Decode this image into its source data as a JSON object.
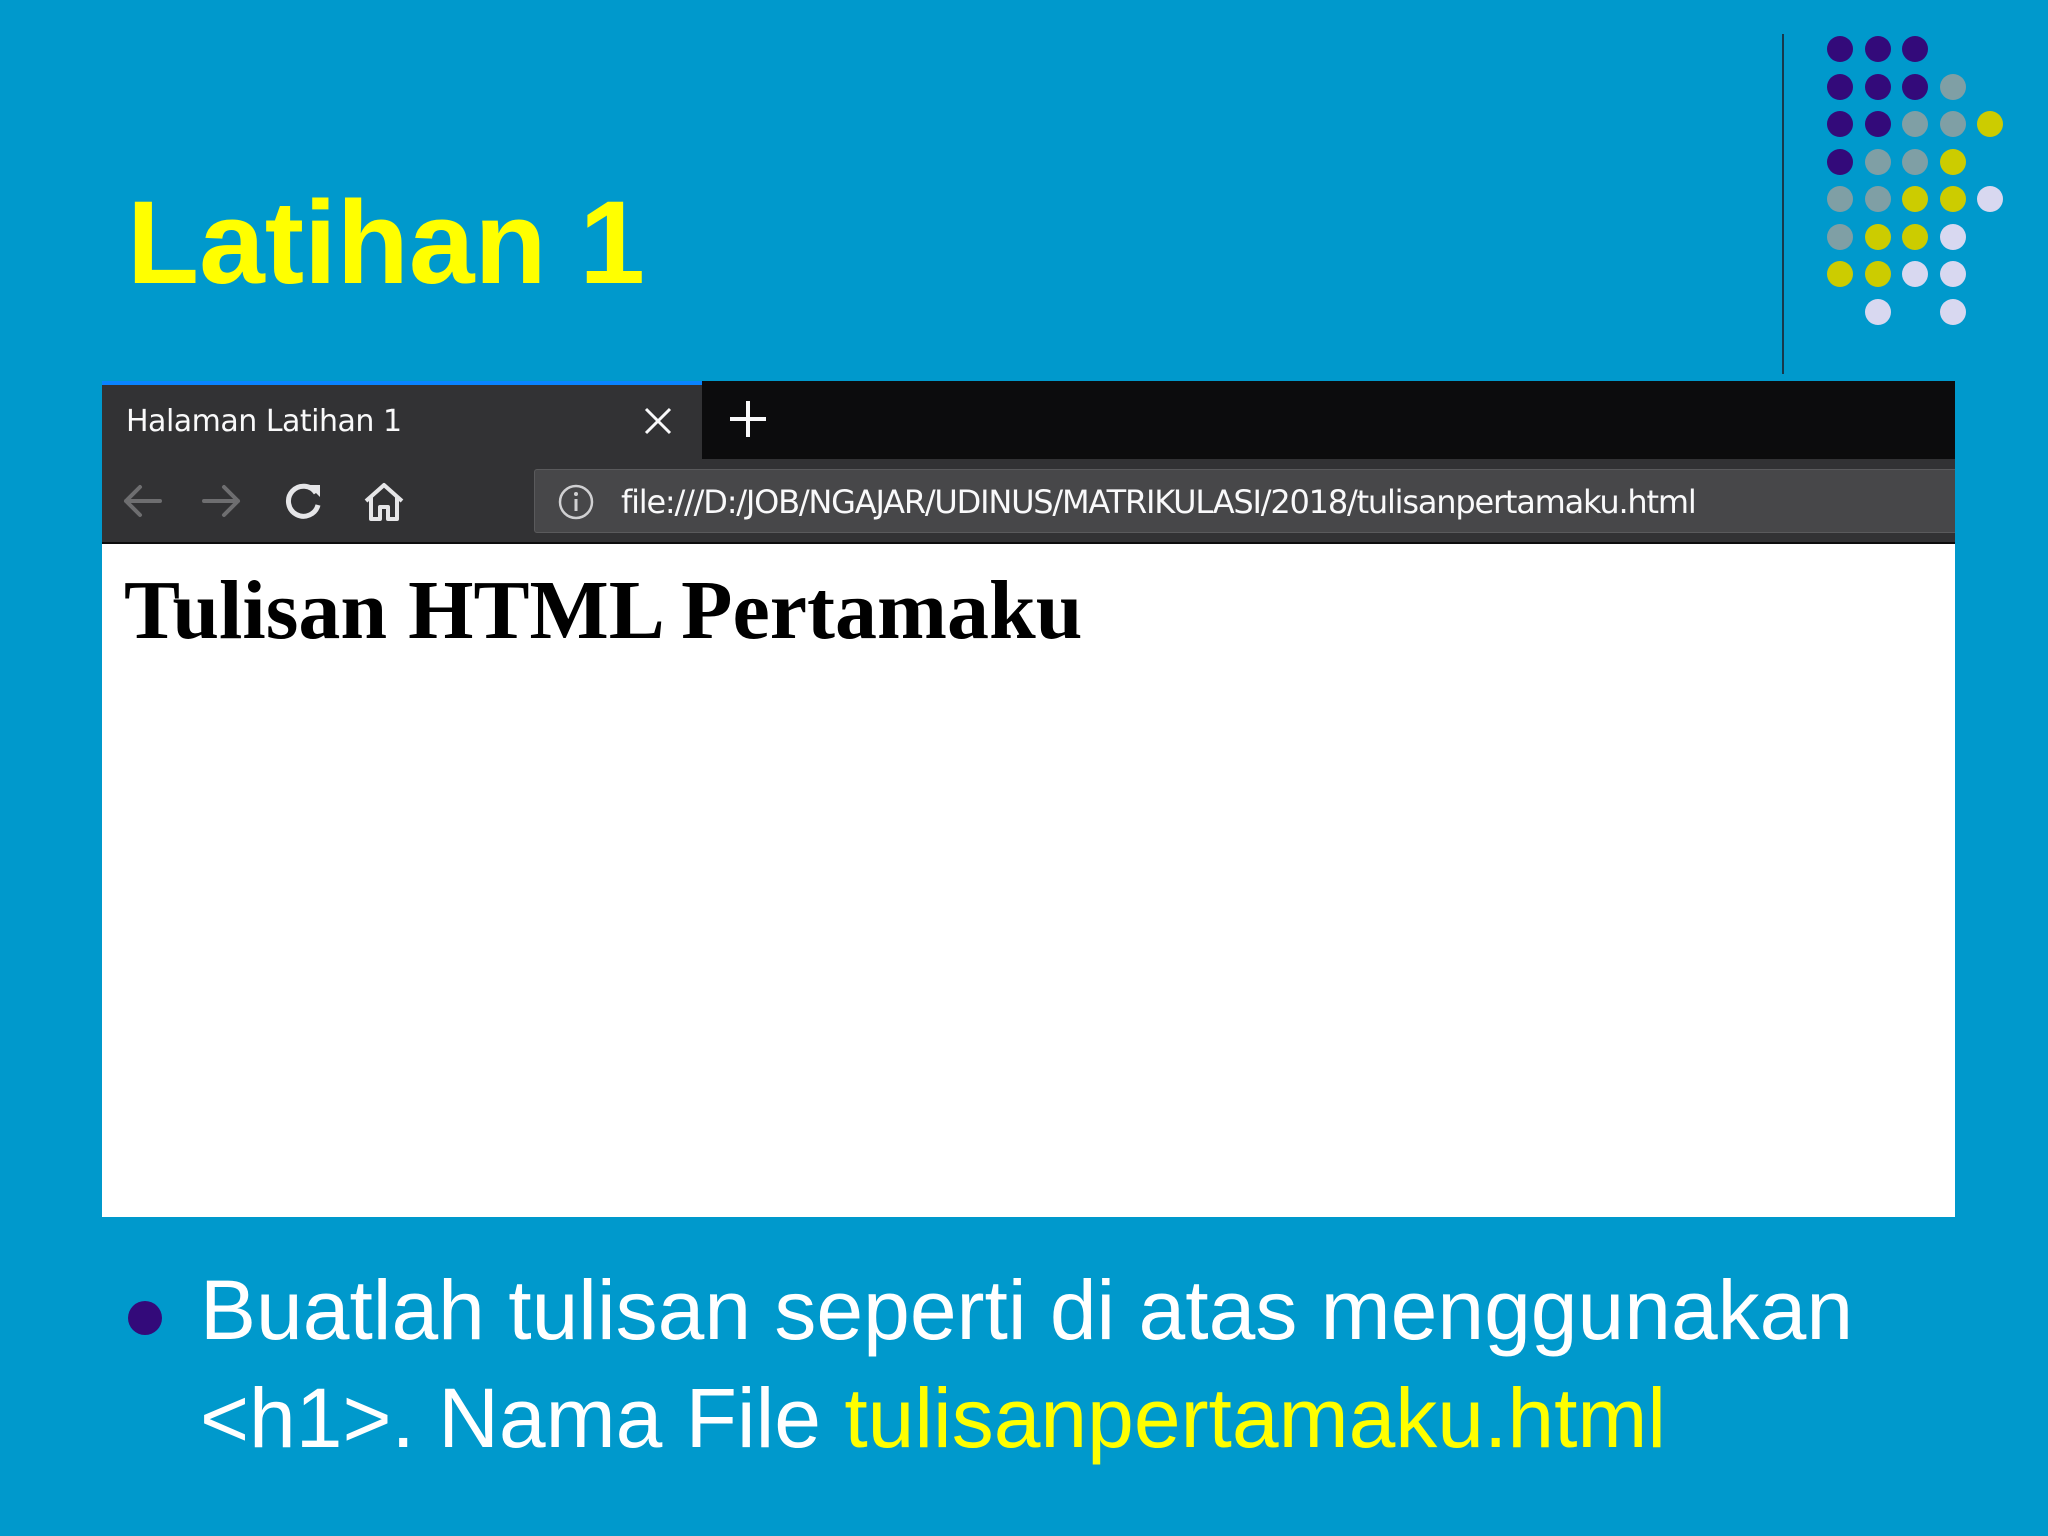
{
  "slide": {
    "title": "Latihan 1",
    "bullet": {
      "line1": "Buatlah tulisan seperti di atas menggunakan",
      "line2_prefix": "<h1>. Nama File ",
      "filename": "tulisanpertamaku.html"
    },
    "colors": {
      "background": "#0099cc",
      "title": "#ffff00",
      "bullet_dot": "#330a7a",
      "highlight": "#ffff00"
    }
  },
  "browser": {
    "tab": {
      "title": "Halaman Latihan 1",
      "close_icon": "close-icon"
    },
    "new_tab_icon": "plus-icon",
    "nav": {
      "back_icon": "arrow-left-icon",
      "forward_icon": "arrow-right-icon",
      "reload_icon": "reload-icon",
      "home_icon": "home-icon"
    },
    "url": {
      "info_icon": "info-icon",
      "value": "file:///D:/JOB/NGAJAR/UDINUS/MATRIKULASI/2018/tulisanpertamaku.html"
    },
    "page": {
      "heading": "Tulisan HTML Pertamaku"
    }
  },
  "decoration": {
    "dot_colors": [
      "#330a7a",
      "#7f9fa5",
      "#cccc00",
      "#d8d8f0"
    ]
  }
}
